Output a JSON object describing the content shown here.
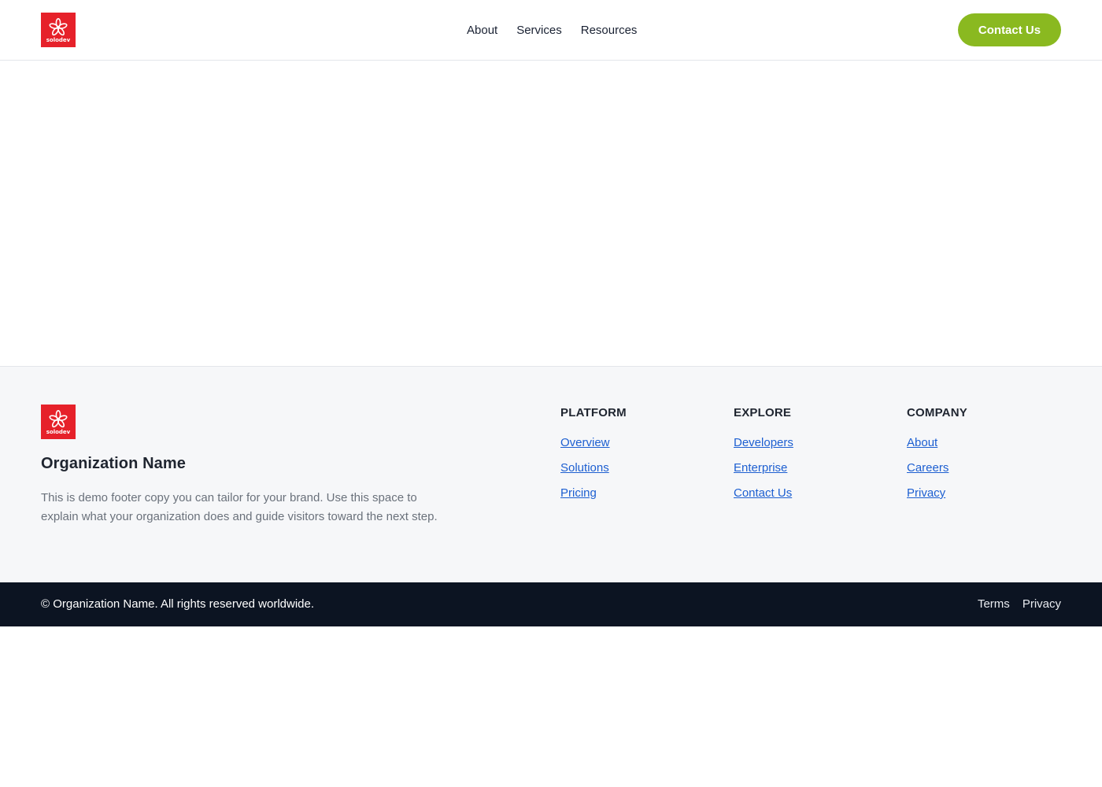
{
  "header": {
    "logo_text": "solodev",
    "nav": [
      {
        "label": "About"
      },
      {
        "label": "Services"
      },
      {
        "label": "Resources"
      }
    ],
    "cta_label": "Contact Us"
  },
  "footer": {
    "logo_text": "solodev",
    "org_name": "Organization Name",
    "description": "This is demo footer copy you can tailor for your brand. Use this space to explain what your organization does and guide visitors toward the next step.",
    "columns": [
      {
        "heading": "PLATFORM",
        "links": [
          "Overview",
          "Solutions",
          "Pricing"
        ]
      },
      {
        "heading": "EXPLORE",
        "links": [
          "Developers",
          "Enterprise",
          "Contact Us"
        ]
      },
      {
        "heading": "COMPANY",
        "links": [
          "About",
          "Careers",
          "Privacy"
        ]
      }
    ]
  },
  "bottom_bar": {
    "copyright": "© Organization Name. All rights reserved worldwide.",
    "links": [
      "Terms",
      "Privacy"
    ]
  },
  "colors": {
    "brand_red": "#e6212a",
    "cta_green": "#8ab920",
    "link_blue": "#1d5fd1",
    "bottom_bar_bg": "#0c1422"
  },
  "icons": {
    "logo_mark": "flower-icon"
  }
}
